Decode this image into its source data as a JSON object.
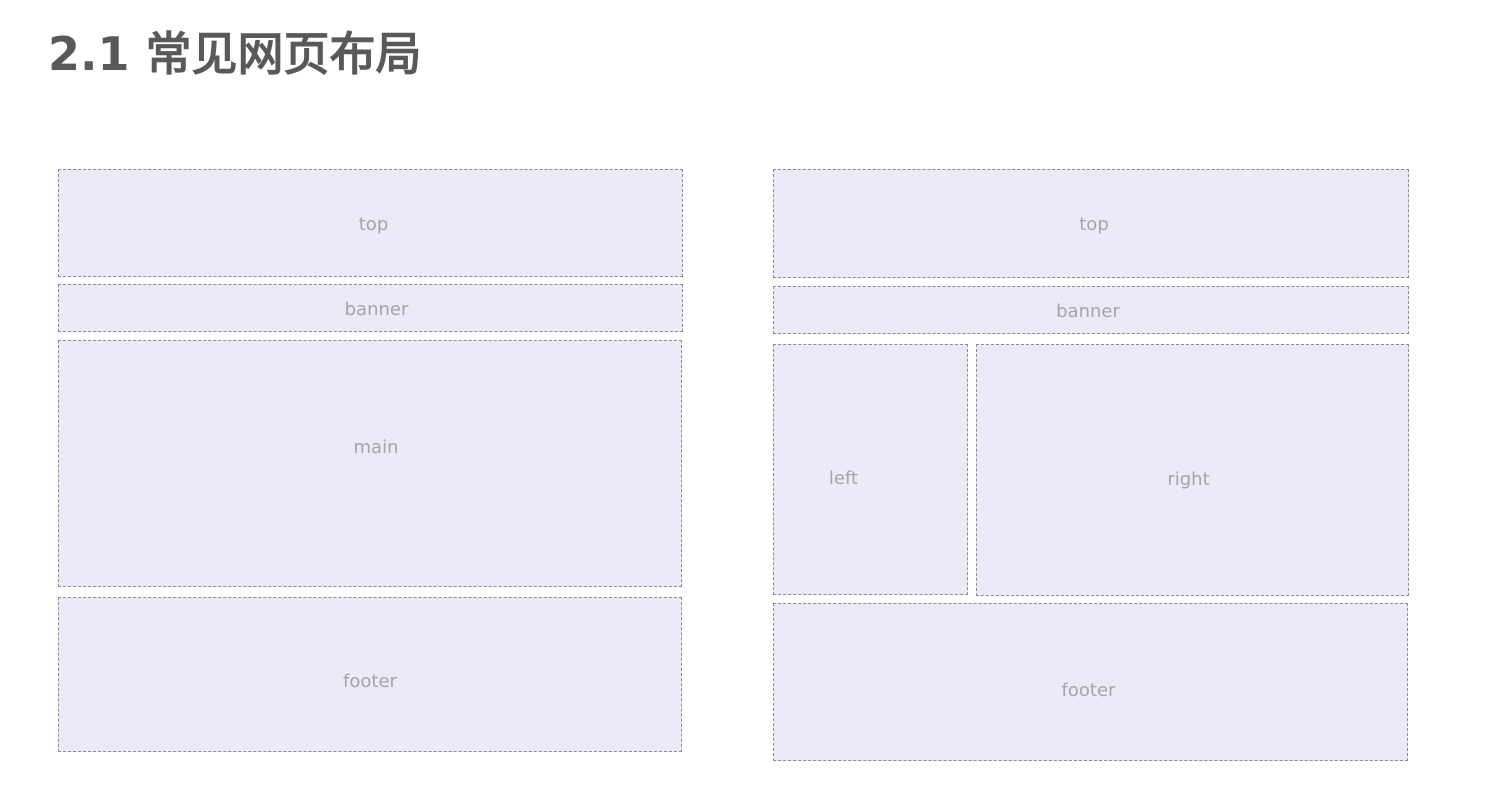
{
  "title": "2.1 常见网页布局",
  "layout_a": {
    "top": "top",
    "banner": "banner",
    "main": "main",
    "footer": "footer"
  },
  "layout_b": {
    "top": "top",
    "banner": "banner",
    "left": "left",
    "right": "right",
    "footer": "footer"
  }
}
